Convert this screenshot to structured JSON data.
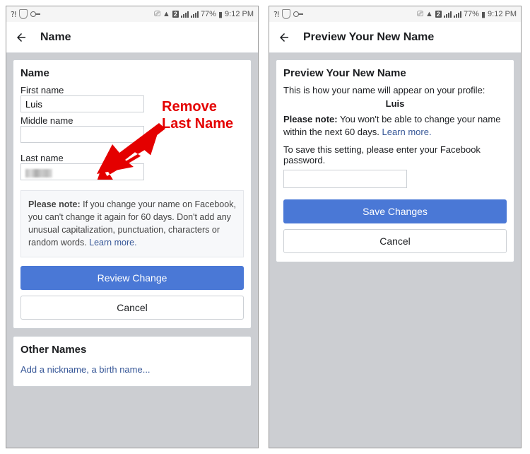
{
  "status": {
    "battery": "77%",
    "time": "9:12 PM",
    "badge": "2"
  },
  "left": {
    "header_title": "Name",
    "card_title": "Name",
    "first_label": "First name",
    "first_value": "Luis",
    "middle_label": "Middle name",
    "middle_value": "",
    "last_label": "Last name",
    "last_value": "",
    "note_prefix": "Please note:",
    "note_body": " If you change your name on Facebook, you can't change it again for 60 days. Don't add any unusual capitalization, punctuation, characters or random words. ",
    "learn_more": "Learn more.",
    "review_btn": "Review Change",
    "cancel_btn": "Cancel",
    "other_names_title": "Other Names",
    "other_names_hint": "Add a nickname, a birth name..."
  },
  "right": {
    "header_title": "Preview Your New Name",
    "card_title": "Preview Your New Name",
    "intro": "This is how your name will appear on your profile:",
    "display_name": "Luis",
    "note_prefix": "Please note:",
    "note_body": " You won't be able to change your name within the next 60 days. ",
    "learn_more": "Learn more.",
    "pw_prompt": "To save this setting, please enter your Facebook password.",
    "save_btn": "Save Changes",
    "cancel_btn": "Cancel"
  },
  "annotation": {
    "line1": "Remove",
    "line2": "Last Name"
  }
}
